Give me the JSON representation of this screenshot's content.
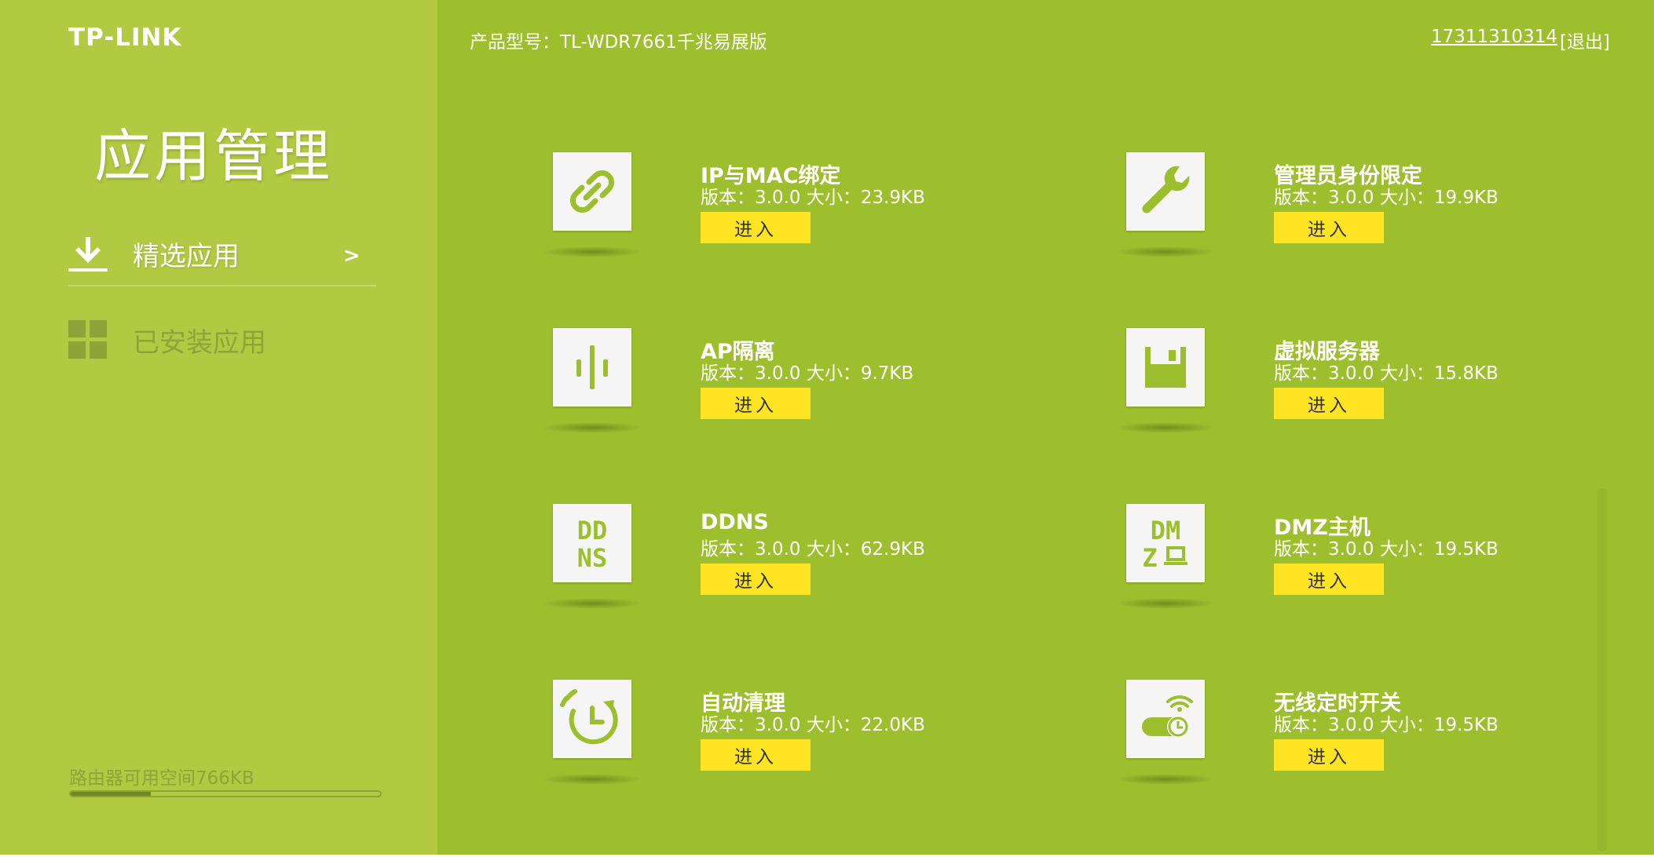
{
  "brand": "TP-LINK",
  "sidebar": {
    "title": "应用管理",
    "nav": [
      {
        "label": "精选应用",
        "icon": "download-icon",
        "arrow": ">"
      },
      {
        "label": "已安装应用",
        "icon": "grid-icon"
      }
    ],
    "storage": {
      "text": "路由器可用空间766KB",
      "used_fraction": 0.26
    }
  },
  "header": {
    "product": "产品型号：TL-WDR7661千兆易展版",
    "account": "17311310314",
    "logout": "[退出]"
  },
  "apps": [
    {
      "name": "IP与MAC绑定",
      "meta": "版本：3.0.0  大小：23.9KB",
      "button": "进入",
      "icon": "link-icon"
    },
    {
      "name": "管理员身份限定",
      "meta": "版本：3.0.0  大小：19.9KB",
      "button": "进入",
      "icon": "wrench-icon"
    },
    {
      "name": "AP隔离",
      "meta": "版本：3.0.0  大小：9.7KB",
      "button": "进入",
      "icon": "ap-isolation-icon"
    },
    {
      "name": "虚拟服务器",
      "meta": "版本：3.0.0  大小：15.8KB",
      "button": "进入",
      "icon": "floppy-icon"
    },
    {
      "name": "DDNS",
      "meta": "版本：3.0.0  大小：62.9KB",
      "button": "进入",
      "icon": "ddns-icon"
    },
    {
      "name": "DMZ主机",
      "meta": "版本：3.0.0  大小：19.5KB",
      "button": "进入",
      "icon": "dmz-icon"
    },
    {
      "name": "自动清理",
      "meta": "版本：3.0.0  大小：22.0KB",
      "button": "进入",
      "icon": "auto-clean-icon"
    },
    {
      "name": "无线定时开关",
      "meta": "版本：3.0.0  大小：19.5KB",
      "button": "进入",
      "icon": "wifi-timer-icon"
    }
  ],
  "icon_glyphs": {
    "ddns": [
      "DD",
      "NS"
    ],
    "dmz": [
      "DM",
      "Z"
    ]
  },
  "colors": {
    "sidebar": "#b2c942",
    "main": "#9dbf2e",
    "button": "#ffe423"
  }
}
